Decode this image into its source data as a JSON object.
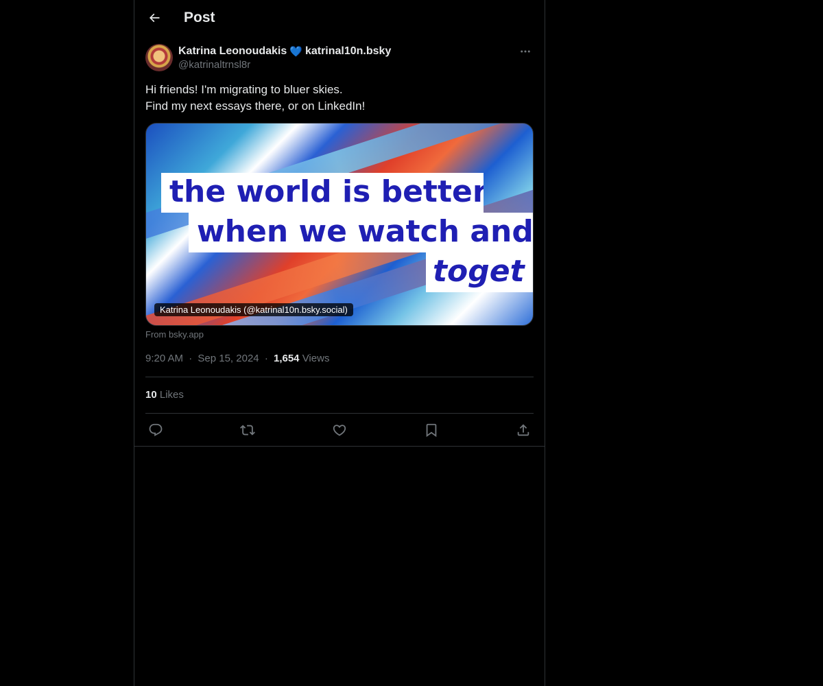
{
  "header": {
    "back_icon": "arrow-left-icon",
    "title": "Post"
  },
  "post": {
    "author_name": "Katrina Leonoudakis",
    "author_badge": "💙",
    "author_suffix": "katrinal10n.bsky",
    "handle": "@katrinaltrnsl8r",
    "more_icon": "more-horizontal-icon",
    "text_lines": [
      "Hi friends! I'm migrating to bluer skies.",
      "Find my next essays there, or on LinkedIn!"
    ],
    "card": {
      "banner_line_1": "the world is better",
      "banner_line_2": "when we watch and",
      "banner_line_3": "toget",
      "caption": "Katrina Leonoudakis (@katrinal10n.bsky.social)"
    },
    "from": "From bsky.app",
    "time": "9:20 AM",
    "date": "Sep 15, 2024",
    "separator": "·",
    "views_count": "1,654",
    "views_label": "Views",
    "likes_count": "10",
    "likes_label": "Likes"
  },
  "actions": [
    {
      "name": "reply",
      "icon": "reply-icon"
    },
    {
      "name": "repost",
      "icon": "repost-icon"
    },
    {
      "name": "like",
      "icon": "heart-icon"
    },
    {
      "name": "bookmark",
      "icon": "bookmark-icon"
    },
    {
      "name": "share",
      "icon": "share-icon"
    }
  ],
  "colors": {
    "background": "#000000",
    "text_primary": "#e7e9ea",
    "text_secondary": "#71767b",
    "border": "#2f3336",
    "badge_blue": "#5aa9e6"
  }
}
